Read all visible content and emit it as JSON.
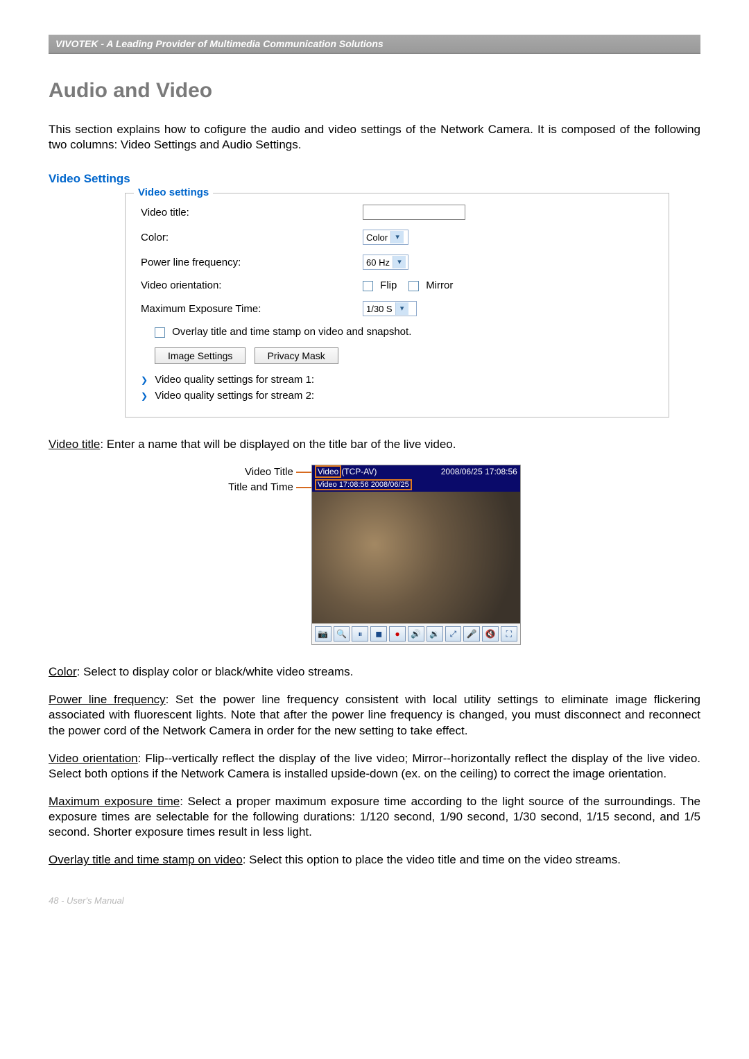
{
  "header": {
    "brand": "VIVOTEK - A Leading Provider of Multimedia Communication Solutions"
  },
  "title": "Audio and Video",
  "intro": "This section explains how to cofigure the audio and video settings of the Network Camera. It is composed of the following two columns: Video Settings and Audio Settings.",
  "video_settings": {
    "heading": "Video Settings",
    "legend": "Video settings",
    "rows": {
      "video_title_label": "Video title:",
      "color_label": "Color:",
      "color_value": "Color",
      "plf_label": "Power line frequency:",
      "plf_value": "60 Hz",
      "orient_label": "Video orientation:",
      "orient_flip": "Flip",
      "orient_mirror": "Mirror",
      "exposure_label": "Maximum Exposure Time:",
      "exposure_value": "1/30 S",
      "overlay_label": "Overlay title and time stamp on video and snapshot.",
      "btn_image": "Image Settings",
      "btn_privacy": "Privacy Mask",
      "stream1": "Video quality settings for stream 1:",
      "stream2": "Video quality settings for stream 2:"
    }
  },
  "figure": {
    "label_video_title": "Video Title",
    "label_title_time": "Title and Time",
    "bar1_left": "Video",
    "bar1_left_suffix": "(TCP-AV)",
    "bar1_right": "2008/06/25 17:08:56",
    "bar2": "Video 17:08:56  2008/06/25"
  },
  "descriptions": {
    "video_title_term": "Video title",
    "video_title_text": ": Enter a name that will be displayed on the title bar of the live video.",
    "color_term": "Color",
    "color_text": ": Select to display color or black/white video streams.",
    "plf_term": "Power line frequency",
    "plf_text": ": Set the power line frequency consistent with local utility settings to eliminate image flickering associated with fluorescent lights. Note that after the power line frequency is changed, you must disconnect and reconnect the power cord of the Network Camera in order for the new setting to take effect.",
    "orient_term": "Video orientation",
    "orient_text": ": Flip--vertically reflect the display of the live video; Mirror--horizontally reflect the display of the live video. Select both options if the Network Camera is installed upside-down (ex. on the ceiling) to correct the image orientation.",
    "exposure_term": "Maximum exposure time",
    "exposure_text": ": Select a proper maximum exposure time according to the light source of the surroundings. The exposure times are selectable for the following durations: 1/120 second, 1/90 second, 1/30 second, 1/15 second, and 1/5 second. Shorter exposure times result in less light.",
    "overlay_term": "Overlay title and time stamp on video",
    "overlay_text": ": Select this option to place the video title and time on the video streams."
  },
  "footer": "48 - User's Manual"
}
